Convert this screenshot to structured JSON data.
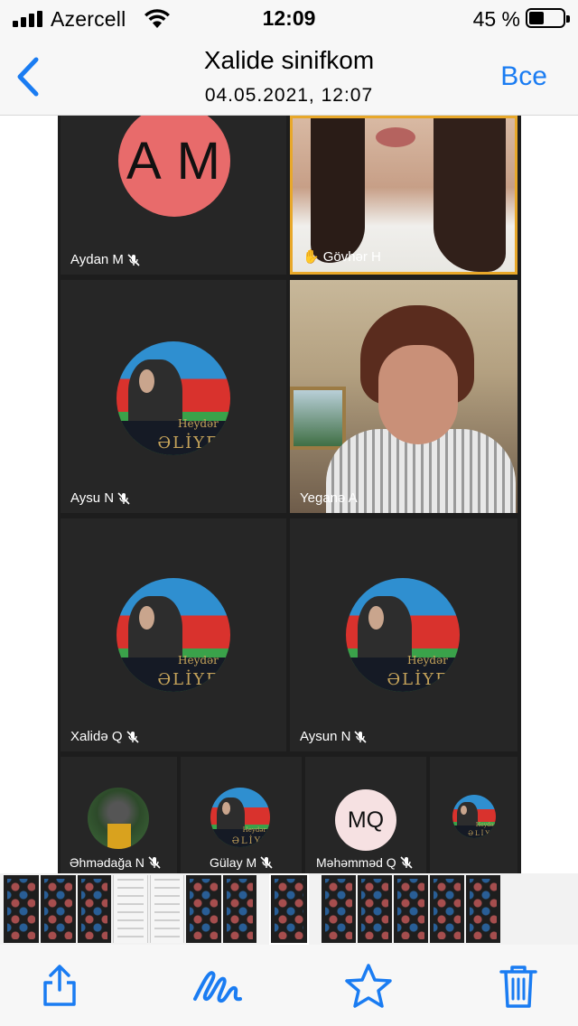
{
  "status_bar": {
    "carrier": "Azercell",
    "time": "12:09",
    "battery_percent": "45 %",
    "battery_level": 0.45,
    "icons": [
      "signal-icon",
      "wifi-icon",
      "battery-icon"
    ]
  },
  "nav": {
    "back_icon": "chevron-left-icon",
    "title": "Xalide sinifkom",
    "subtitle": "04.05.2021, 12:07",
    "all_label": "Все"
  },
  "meeting": {
    "tiles": [
      {
        "name": "Aydan M",
        "initials": "A M",
        "muted": true
      },
      {
        "name": "Gövhər H",
        "raised_hand": true
      },
      {
        "name": "Aysu N",
        "muted": true,
        "avatar": "flag-avatar"
      },
      {
        "name": "Yeganə A",
        "video": true
      },
      {
        "name": "Xalidə Q",
        "muted": true,
        "avatar": "flag-avatar"
      },
      {
        "name": "Aysun N",
        "muted": true,
        "avatar": "flag-avatar"
      }
    ],
    "small_tiles": [
      {
        "name": "Əhmədağa N",
        "muted": true
      },
      {
        "name": "Gülay M",
        "muted": true
      },
      {
        "name": "Məhəmməd Q",
        "initials": "MQ",
        "muted": true
      },
      {
        "name": "",
        "muted": false
      }
    ],
    "avatar_text_1": "Heydər",
    "avatar_text_2": "ƏLİYEV",
    "hand_icon": "✋"
  },
  "toolbar": {
    "share_icon": "share-icon",
    "markup_icon": "markup-icon",
    "favorite_icon": "star-icon",
    "delete_icon": "trash-icon",
    "accent": "#1a7cf2"
  }
}
